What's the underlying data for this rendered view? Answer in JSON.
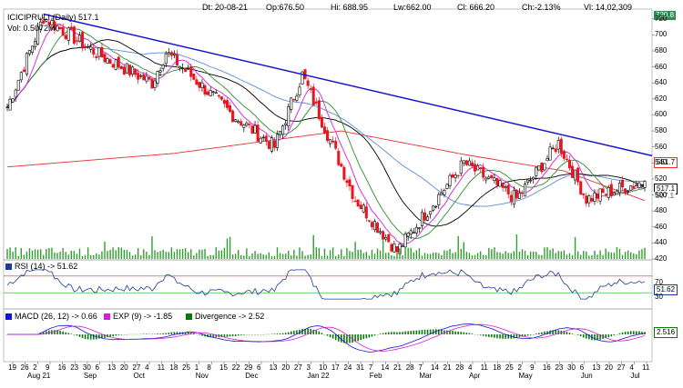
{
  "header": {
    "symbol": "ICICIPRULI (Daily) 517.1",
    "volume": "Vol: 0.5072M",
    "date": "Dt: 20-08-21",
    "open": "Op:676.50",
    "high": "Hi: 688.95",
    "low": "Lw:662.00",
    "close": "Cl: 666.20",
    "change": "Ch:-2.13%",
    "vol": "Vl: 14,02,309"
  },
  "price_tags": {
    "top": "720.8",
    "ma200": "551.7",
    "last": "517.1",
    "ma_low": "507.1"
  },
  "y_axis": [
    "720",
    "700",
    "680",
    "660",
    "640",
    "620",
    "600",
    "580",
    "560",
    "540",
    "520",
    "500",
    "480",
    "460",
    "440",
    "420"
  ],
  "x_axis": {
    "days": [
      "19",
      "26",
      "2",
      "9",
      "16",
      "23",
      "30",
      "6",
      "13",
      "20",
      "27",
      "4",
      "11",
      "18",
      "25",
      "1",
      "8",
      "15",
      "22",
      "29",
      "6",
      "13",
      "20",
      "27",
      "3",
      "10",
      "17",
      "24",
      "31",
      "7",
      "14",
      "21",
      "28",
      "7",
      "14",
      "21",
      "28",
      "4",
      "11",
      "18",
      "25",
      "2",
      "9",
      "16",
      "23",
      "30",
      "6",
      "13",
      "20",
      "27",
      "4",
      "11"
    ],
    "months": [
      "Aug 21",
      "Sep",
      "Oct",
      "Nov",
      "Dec",
      "Jan 22",
      "Feb",
      "Mar",
      "Apr",
      "May",
      "Jun",
      "Jul"
    ]
  },
  "rsi": {
    "legend": "RSI (14) -> 51.62",
    "value_tag": "51.62",
    "levels": [
      "70",
      "30"
    ]
  },
  "macd": {
    "legend_macd": "MACD (26, 12) -> 0.66",
    "legend_exp": "EXP (9) -> -1.85",
    "legend_div": "Divergence -> 2.52",
    "value_tag": "2.516"
  },
  "colors": {
    "candle_up": "#ffffff",
    "candle_down": "#e8141e",
    "volume": "#2fa02f",
    "trendline": "#1414d2",
    "ma_red": "#e83232",
    "ma_blue": "#5a8cdc",
    "ma_black": "#000000",
    "ma_green": "#2e8b2e",
    "ma_magenta": "#d420d4",
    "rsi_line": "#1e3c96",
    "macd_line": "#1414d2",
    "exp_line": "#d420d4",
    "divergence": "#0a780a"
  },
  "chart_data": {
    "type": "candlestick",
    "symbol": "ICICIPRULI",
    "timeframe": "Daily",
    "ylim": [
      420,
      730
    ],
    "last_close": 517.1,
    "key_points": [
      {
        "date": "Aug 21",
        "close": 610
      },
      {
        "date": "Sep 6",
        "close": 722
      },
      {
        "date": "Oct 4",
        "close": 675
      },
      {
        "date": "Nov 1",
        "close": 640
      },
      {
        "date": "Nov 8",
        "close": 678
      },
      {
        "date": "Dec 13",
        "close": 600
      },
      {
        "date": "Jan 3",
        "close": 560
      },
      {
        "date": "Jan 17",
        "close": 650
      },
      {
        "date": "Feb 14",
        "close": 495
      },
      {
        "date": "Mar 7",
        "close": 430
      },
      {
        "date": "Apr 11",
        "close": 540
      },
      {
        "date": "May 9",
        "close": 495
      },
      {
        "date": "Jun 6",
        "close": 565
      },
      {
        "date": "Jun 20",
        "close": 495
      },
      {
        "date": "Jul 11",
        "close": 517.1
      }
    ],
    "trendline": {
      "from": {
        "date": "Sep 6",
        "price": 726
      },
      "to": {
        "date": "Jul 15",
        "price": 549
      }
    },
    "indicators": {
      "rsi_14": 51.62,
      "macd_26_12": 0.66,
      "exp_9": -1.85,
      "divergence": 2.52
    }
  }
}
